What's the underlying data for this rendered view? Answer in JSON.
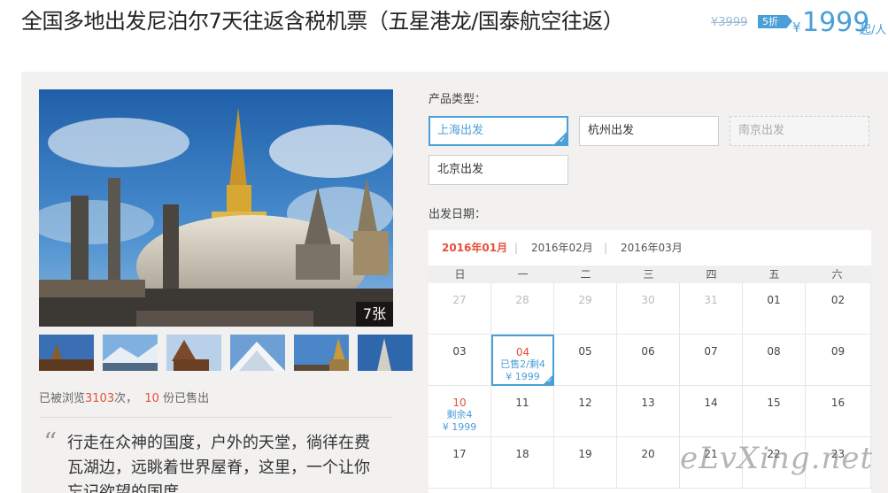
{
  "header": {
    "title": "全国多地出发尼泊尔7天往返含税机票（五星港龙/国泰航空往返）",
    "old_price": "¥3999",
    "discount": "5折",
    "currency": "¥",
    "price": "1999",
    "unit": "起/人"
  },
  "gallery": {
    "photo_count": "7张",
    "thumbnail_count": 6
  },
  "stats": {
    "viewed_prefix": "已被浏览",
    "viewed_count": "3103",
    "viewed_suffix": "次，",
    "sold_count": "10",
    "sold_suffix": "份已售出"
  },
  "description": {
    "quote_mark": "“",
    "text": "行走在众神的国度，户外的天堂，徜徉在费瓦湖边，远眺着世界屋脊，这里，一个让你忘记欲望的国度。"
  },
  "product_type": {
    "label": "产品类型：",
    "options": [
      "上海出发",
      "杭州出发",
      "南京出发",
      "北京出发"
    ]
  },
  "departure": {
    "label": "出发日期："
  },
  "calendar": {
    "months": [
      "2016年01月",
      "2016年02月",
      "2016年03月"
    ],
    "separator": "|",
    "weekdays": [
      "日",
      "一",
      "二",
      "三",
      "四",
      "五",
      "六"
    ],
    "days": [
      "27",
      "28",
      "29",
      "30",
      "31",
      "01",
      "02",
      "03",
      "04",
      "05",
      "06",
      "07",
      "08",
      "09",
      "10",
      "11",
      "12",
      "13",
      "14",
      "15",
      "16",
      "17",
      "18",
      "19",
      "20",
      "21",
      "22",
      "23"
    ],
    "cell_04_info1": "已售2/剩4",
    "cell_04_info2": "¥ 1999",
    "cell_10_info1": "剩余4",
    "cell_10_info2": "¥ 1999"
  },
  "watermark": "eLvXing.net",
  "colors": {
    "accent": "#4a9fd8",
    "highlight": "#e4513a",
    "panel": "#f2f1f0"
  }
}
